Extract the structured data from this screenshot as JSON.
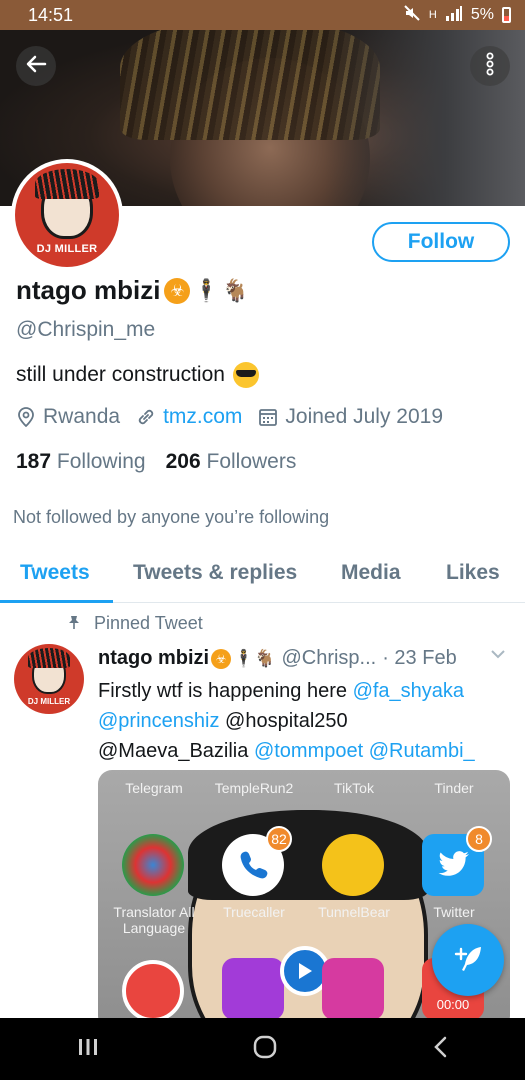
{
  "status_bar": {
    "time": "14:51",
    "network": "H",
    "battery": "5%"
  },
  "profile": {
    "avatar_label": "DJ MILLER",
    "follow_label": "Follow",
    "display_name": "ntago mbizi",
    "handle": "@Chrispin_me",
    "bio": "still under construction",
    "location": "Rwanda",
    "website": "tmz.com",
    "joined": "Joined July 2019",
    "following_count": "187",
    "following_label": "Following",
    "followers_count": "206",
    "followers_label": "Followers",
    "not_followed_note": "Not followed by anyone you’re following"
  },
  "tabs": [
    {
      "label": "Tweets",
      "active": true
    },
    {
      "label": "Tweets & replies",
      "active": false
    },
    {
      "label": "Media",
      "active": false
    },
    {
      "label": "Likes",
      "active": false
    }
  ],
  "tweet": {
    "pinned_label": "Pinned Tweet",
    "avatar_label": "DJ MILLER",
    "name": "ntago mbizi",
    "handle": "@Chrisp...",
    "date": "· 23 Feb",
    "text_plain_1": "Firstly wtf is happening here ",
    "mention_1": "@fa_shyaka",
    "mention_2": "@princenshiz",
    "text_plain_2": " @hospital250",
    "text_plain_3": "@Maeva_Bazilia ",
    "mention_3": "@tommpoet",
    "mention_4": "@Rutambi_",
    "media": {
      "apps_row1": [
        "Telegram",
        "TempleRun2",
        "TikTok",
        "Tinder"
      ],
      "apps_row2": [
        "Translator All Language",
        "Truecaller",
        "TunnelBear",
        "Twitter"
      ],
      "truecaller_badge": "82",
      "twitter_badge": "8",
      "timer": "00:00"
    }
  },
  "colors": {
    "accent": "#1da1f2",
    "status_bar": "#8a5a38",
    "secondary_text": "#657786"
  }
}
